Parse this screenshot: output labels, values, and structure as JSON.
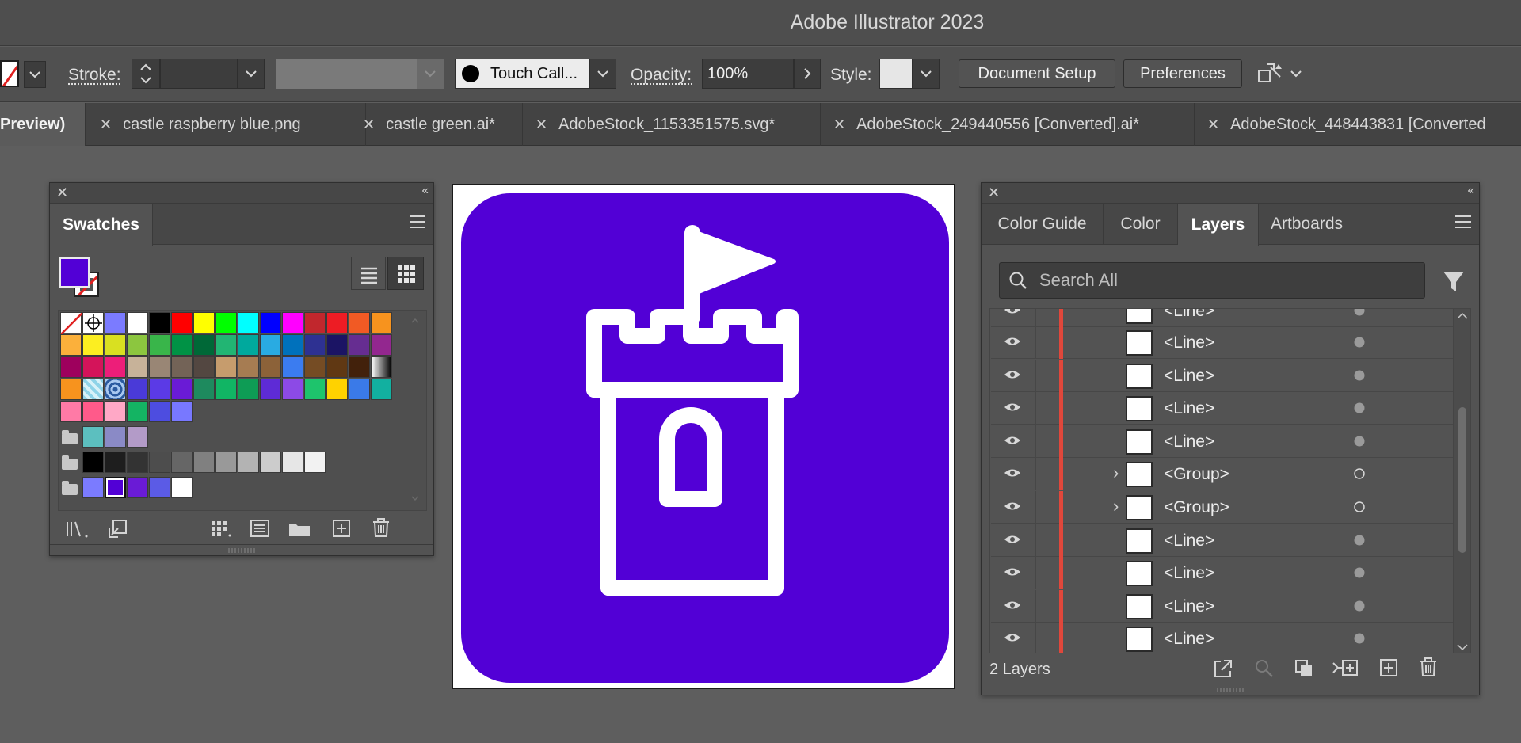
{
  "app": {
    "title": "Adobe Illustrator 2023"
  },
  "controlbar": {
    "stroke_label": "Stroke:",
    "brush_name": "Touch Call...",
    "opacity_label": "Opacity:",
    "opacity_value": "100%",
    "style_label": "Style:",
    "document_setup": "Document Setup",
    "preferences": "Preferences"
  },
  "tabs": [
    {
      "label": "Preview)",
      "active": true,
      "closable": false
    },
    {
      "label": "castle raspberry blue.png",
      "active": false,
      "closable": true
    },
    {
      "label": "castle green.ai*",
      "active": false,
      "closable": true
    },
    {
      "label": "AdobeStock_1153351575.svg*",
      "active": false,
      "closable": true
    },
    {
      "label": "AdobeStock_249440556 [Converted].ai*",
      "active": false,
      "closable": true
    },
    {
      "label": "AdobeStock_448443831 [Converted",
      "active": false,
      "closable": true
    }
  ],
  "swatches_panel": {
    "tab": "Swatches",
    "fill_color": "#5200d6",
    "grid": [
      [
        "none",
        "reg",
        "#7b7bff",
        "#ffffff",
        "#000000",
        "#ff0000",
        "#ffff00",
        "#00ff00",
        "#00ffff",
        "#0000ff",
        "#ff00ff",
        "#c1272d",
        "#ed1c24",
        "#f15a24",
        "#f7931e"
      ],
      [
        "#fbb03b",
        "#fcee21",
        "#d9e021",
        "#8cc63f",
        "#39b54a",
        "#009245",
        "#006837",
        "#22b573",
        "#00a99d",
        "#29abe2",
        "#0071bc",
        "#2e3192",
        "#1b1464",
        "#662d91",
        "#93278f"
      ],
      [
        "#9e005d",
        "#d4145a",
        "#ed1e79",
        "#c7b299",
        "#998675",
        "#736357",
        "#534741",
        "#c69c6d",
        "#a67c52",
        "#8c6239",
        "#3b7cf0",
        "#754c24",
        "#603813",
        "#42210b",
        "grad"
      ],
      [
        "#f7931e",
        "pat1",
        "pat2",
        "#4a3ad8",
        "#5b3ae6",
        "#6a1bd6",
        "#1e8a5e",
        "#11b564",
        "#0e9c55",
        "#5e2bd6",
        "#8c4ae6",
        "#1ec46c",
        "#ffd200",
        "#3a7ae8",
        "#12b0a0"
      ],
      [
        "#ff7aa6",
        "#ff5a8a",
        "#ffa8c6",
        "#14b463",
        "#4d4de0",
        "#7878ff"
      ]
    ],
    "group_rows": [
      [
        "#5cbfbf",
        "#8a8ac6",
        "#b39bc8"
      ],
      [
        "#000000",
        "#1e1e1e",
        "#333333",
        "#4d4d4d",
        "#666666",
        "#808080",
        "#999999",
        "#b3b3b3",
        "#cccccc",
        "#e6e6e6",
        "#f2f2f2"
      ],
      [
        "#7b7bff",
        "#5200d6",
        "#6a1bd6",
        "#5b5be6",
        "#ffffff"
      ]
    ]
  },
  "layers_panel": {
    "tabs": [
      "Color Guide",
      "Color",
      "Layers",
      "Artboards"
    ],
    "active_tab": "Layers",
    "search_placeholder": "Search All",
    "partial_row": "<Line>",
    "rows": [
      {
        "name": "<Line>",
        "expandable": false
      },
      {
        "name": "<Line>",
        "expandable": false
      },
      {
        "name": "<Line>",
        "expandable": false
      },
      {
        "name": "<Line>",
        "expandable": false
      },
      {
        "name": "<Group>",
        "expandable": true
      },
      {
        "name": "<Group>",
        "expandable": true
      },
      {
        "name": "<Line>",
        "expandable": false
      },
      {
        "name": "<Line>",
        "expandable": false
      },
      {
        "name": "<Line>",
        "expandable": false
      },
      {
        "name": "<Line>",
        "expandable": false
      }
    ],
    "footer_count": "2 Layers"
  },
  "canvas": {
    "artwork_color": "#5200d6",
    "line_color": "#ffffff"
  }
}
